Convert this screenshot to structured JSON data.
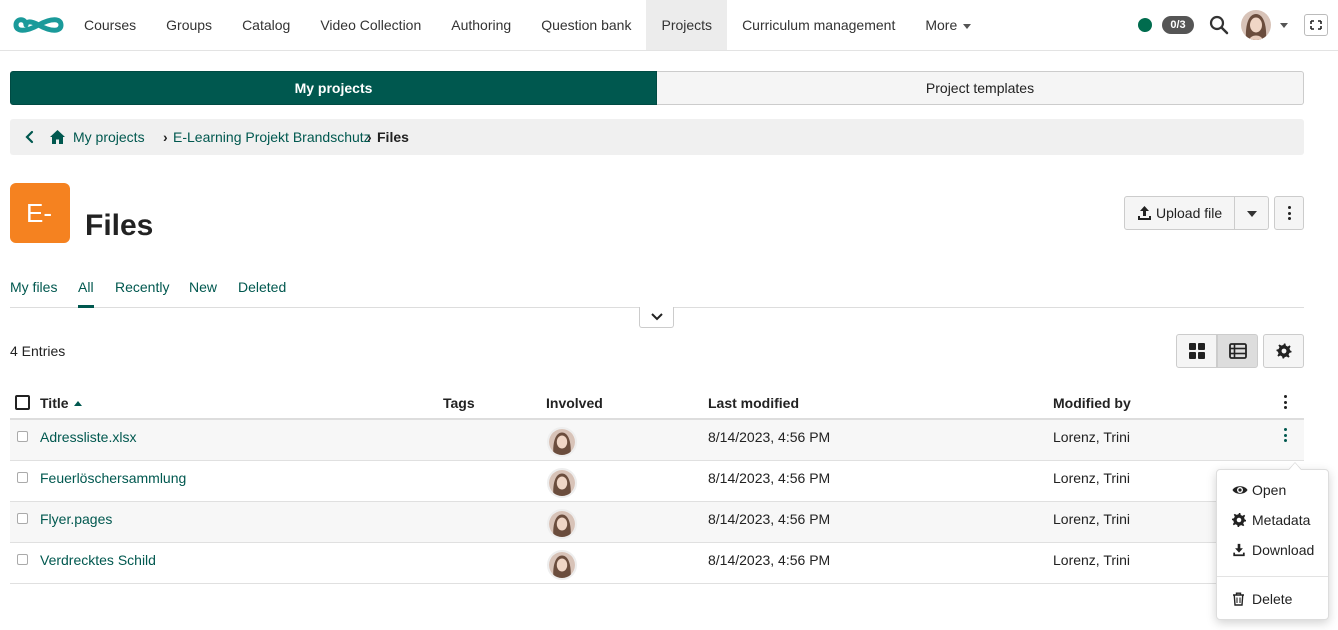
{
  "nav": {
    "items": [
      {
        "label": "Courses"
      },
      {
        "label": "Groups"
      },
      {
        "label": "Catalog"
      },
      {
        "label": "Video Collection"
      },
      {
        "label": "Authoring"
      },
      {
        "label": "Question bank"
      },
      {
        "label": "Projects"
      },
      {
        "label": "Curriculum management"
      },
      {
        "label": "More"
      }
    ],
    "active_item": "Projects",
    "counter": "0/3",
    "status_color": "#006c4e"
  },
  "segments": {
    "my_projects": "My projects",
    "project_templates": "Project templates",
    "active": "My projects"
  },
  "breadcrumb": {
    "items": [
      "My projects",
      "E-Learning Projekt Brandschutz"
    ],
    "current": "Files"
  },
  "header": {
    "avatar_text": "E-",
    "avatar_color": "#f58220",
    "title": "Files",
    "upload_label": "Upload file"
  },
  "tabs": [
    {
      "label": "My files"
    },
    {
      "label": "All"
    },
    {
      "label": "Recently"
    },
    {
      "label": "New"
    },
    {
      "label": "Deleted"
    }
  ],
  "active_tab": "All",
  "entries_label": "4 Entries",
  "table": {
    "columns": [
      "Title",
      "Tags",
      "Involved",
      "Last modified",
      "Modified by"
    ],
    "sorted_column": "Title",
    "rows": [
      {
        "title": "Adressliste.xlsx",
        "tags": "",
        "modified": "8/14/2023, 4:56 PM",
        "modified_by": "Lorenz, Trini"
      },
      {
        "title": "Feuerlöschersammlung",
        "tags": "",
        "modified": "8/14/2023, 4:56 PM",
        "modified_by": "Lorenz, Trini"
      },
      {
        "title": "Flyer.pages",
        "tags": "",
        "modified": "8/14/2023, 4:56 PM",
        "modified_by": "Lorenz, Trini"
      },
      {
        "title": "Verdrecktes Schild",
        "tags": "",
        "modified": "8/14/2023, 4:56 PM",
        "modified_by": "Lorenz, Trini"
      }
    ]
  },
  "context_menu": {
    "items": [
      {
        "label": "Open",
        "icon": "eye-icon"
      },
      {
        "label": "Metadata",
        "icon": "gear-icon"
      },
      {
        "label": "Download",
        "icon": "download-icon"
      },
      {
        "label": "Delete",
        "icon": "trash-icon"
      }
    ]
  },
  "colors": {
    "brand": "#00584f",
    "accent": "#f58220",
    "logo": "#1a9a9a"
  }
}
